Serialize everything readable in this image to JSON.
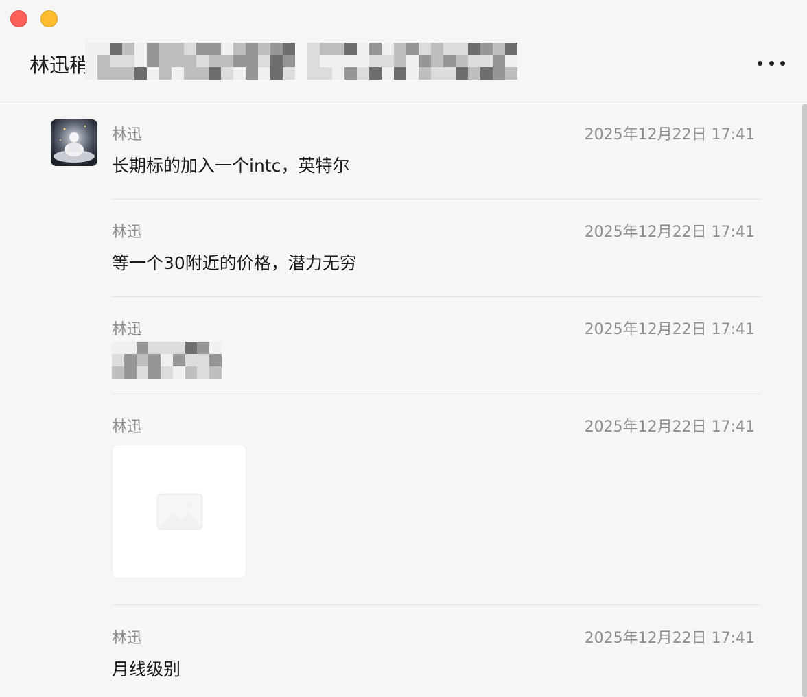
{
  "window": {
    "title_visible": "林迅稍",
    "controls": [
      "close",
      "minimize"
    ],
    "more_icon": "more-horizontal-icon"
  },
  "messages": [
    {
      "sender": "林迅",
      "time": "2025年12月22日 17:41",
      "text": "长期标的加入一个intc，英特尔",
      "has_avatar": true
    },
    {
      "sender": "林迅",
      "time": "2025年12月22日 17:41",
      "text": "等一个30附近的价格，潜力无穷"
    },
    {
      "sender": "林迅",
      "time": "2025年12月22日 17:41",
      "text": "",
      "redacted": true
    },
    {
      "sender": "林迅",
      "time": "2025年12月22日 17:41",
      "image": "image-placeholder-icon"
    },
    {
      "sender": "林迅",
      "time": "2025年12月22日 17:41",
      "text": "月线级别"
    }
  ],
  "colors": {
    "background": "#f6f6f6",
    "close": "#fe5f57",
    "minimize": "#febc2e",
    "meta_text": "#8e8e8e",
    "body_text": "#1a1a1a"
  }
}
